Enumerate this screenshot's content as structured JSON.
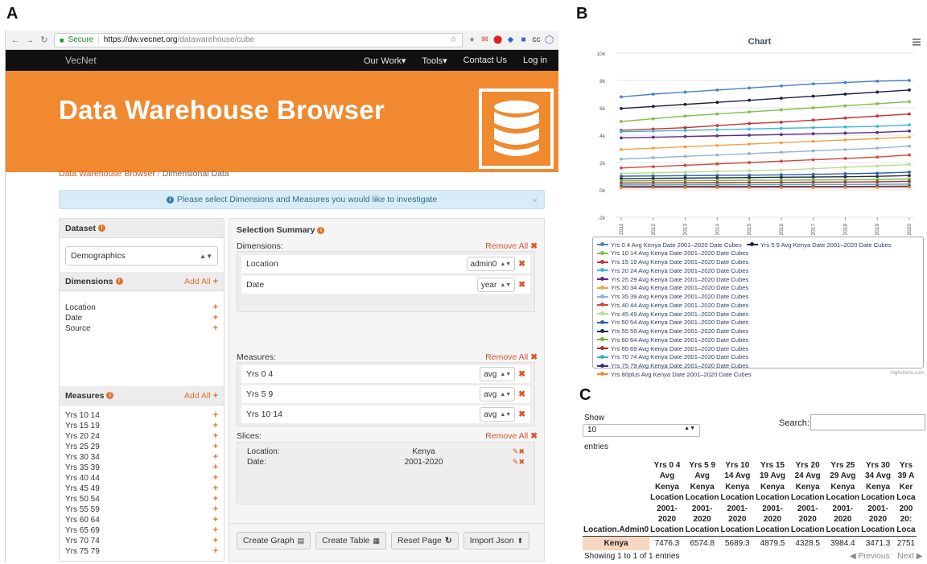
{
  "panel_labels": {
    "a": "A",
    "b": "B",
    "c": "C"
  },
  "browser": {
    "secure_label": "Secure",
    "url_host": "https://dw.vecnet.org",
    "url_path": "/datawarehouse/cube"
  },
  "nav": {
    "brand": "VecNet",
    "links": [
      "Our Work▾",
      "Tools▾",
      "Contact Us",
      "Log in"
    ]
  },
  "hero": {
    "title": "Data Warehouse Browser"
  },
  "breadcrumb": {
    "root": "Data Warehouse Browser",
    "sep": "/",
    "current": "Dimensional Data"
  },
  "alert": {
    "text": "Please select Dimensions and Measures you would like to investigate",
    "close": "×"
  },
  "dataset": {
    "title": "Dataset",
    "selected": "Demographics"
  },
  "dimensions": {
    "title": "Dimensions",
    "add_all": "Add All",
    "items": [
      "Location",
      "Date",
      "Source"
    ]
  },
  "measures": {
    "title": "Measures",
    "add_all": "Add All",
    "items": [
      "Yrs 10 14",
      "Yrs 15 19",
      "Yrs 20 24",
      "Yrs 25 29",
      "Yrs 30 34",
      "Yrs 35 39",
      "Yrs 40 44",
      "Yrs 45 49",
      "Yrs 50 54",
      "Yrs 55 59",
      "Yrs 60 64",
      "Yrs 65 69",
      "Yrs 70 74",
      "Yrs 75 79"
    ]
  },
  "summary": {
    "title": "Selection Summary",
    "remove_all": "Remove All",
    "dimensions_label": "Dimensions:",
    "dimensions": [
      {
        "name": "Location",
        "agg": "admin0"
      },
      {
        "name": "Date",
        "agg": "year"
      }
    ],
    "measures_label": "Measures:",
    "measures": [
      {
        "name": "Yrs 0 4",
        "agg": "avg"
      },
      {
        "name": "Yrs 5 9",
        "agg": "avg"
      },
      {
        "name": "Yrs 10 14",
        "agg": "avg"
      }
    ],
    "slices_label": "Slices:",
    "slices": [
      {
        "key": "Location:",
        "value": "Kenya"
      },
      {
        "key": "Date:",
        "value": "2001-2020"
      }
    ]
  },
  "buttons": {
    "create_graph": "Create Graph",
    "create_table": "Create Table",
    "reset_page": "Reset Page",
    "import_json": "Import Json"
  },
  "chart_data": {
    "type": "line",
    "title": "Chart",
    "x": [
      2011,
      2012,
      2013,
      2014,
      2015,
      2016,
      2017,
      2018,
      2019,
      2020
    ],
    "ylim": [
      -2000,
      10000
    ],
    "yticks": [
      -2000,
      0,
      2000,
      4000,
      6000,
      8000,
      10000
    ],
    "ytick_labels": [
      "-2k",
      "0k",
      "2k",
      "4k",
      "6k",
      "8k",
      "10k"
    ],
    "grid": true,
    "legend_position": "bottom",
    "credits": "Highcharts.com",
    "series": [
      {
        "name": "Yrs 0 4 Avg Kenya Date 2001–2020 Date Cubes",
        "color": "#4a7fcf",
        "values": [
          6800,
          7000,
          7150,
          7300,
          7450,
          7600,
          7750,
          7850,
          7950,
          8000
        ]
      },
      {
        "name": "Yrs 5 9 Avg Kenya Date 2001–2020 Date Cubes",
        "color": "#1c2040",
        "values": [
          5950,
          6100,
          6250,
          6400,
          6550,
          6700,
          6850,
          7000,
          7150,
          7300
        ]
      },
      {
        "name": "Yrs 10 14 Avg Kenya Date 2001–2020 Date Cubes",
        "color": "#7ec04a",
        "values": [
          5000,
          5200,
          5400,
          5550,
          5700,
          5850,
          6000,
          6150,
          6300,
          6450
        ]
      },
      {
        "name": "Yrs 15 19 Avg Kenya Date 2001–2020 Date Cubes",
        "color": "#c9302c",
        "values": [
          4350,
          4450,
          4550,
          4700,
          4850,
          4950,
          5100,
          5250,
          5400,
          5550
        ]
      },
      {
        "name": "Yrs 20 24 Avg Kenya Date 2001–2020 Date Cubes",
        "color": "#3fb7d6",
        "values": [
          4250,
          4300,
          4350,
          4400,
          4450,
          4500,
          4550,
          4600,
          4650,
          4750
        ]
      },
      {
        "name": "Yrs 25 29 Avg Kenya Date 2001–2020 Date Cubes",
        "color": "#5a2e87",
        "values": [
          3800,
          3850,
          3900,
          3950,
          4000,
          4050,
          4100,
          4150,
          4200,
          4300
        ]
      },
      {
        "name": "Yrs 30 34 Avg Kenya Date 2001–2020 Date Cubes",
        "color": "#f4a04a",
        "values": [
          2950,
          3050,
          3150,
          3250,
          3350,
          3450,
          3550,
          3650,
          3750,
          3850
        ]
      },
      {
        "name": "Yrs 35 39 Avg Kenya Date 2001–2020 Date Cubes",
        "color": "#90b4d8",
        "values": [
          2250,
          2350,
          2450,
          2550,
          2650,
          2750,
          2850,
          2950,
          3050,
          3200
        ]
      },
      {
        "name": "Yrs 40 44 Avg Kenya Date 2001–2020 Date Cubes",
        "color": "#d0483c",
        "values": [
          1600,
          1700,
          1800,
          1900,
          2000,
          2100,
          2200,
          2300,
          2400,
          2550
        ]
      },
      {
        "name": "Yrs 45 49 Avg Kenya Date 2001–2020 Date Cubes",
        "color": "#b8dc8c",
        "values": [
          1200,
          1250,
          1300,
          1350,
          1400,
          1450,
          1550,
          1650,
          1750,
          1850
        ]
      },
      {
        "name": "Yrs 50 54 Avg Kenya Date 2001–2020 Date Cubes",
        "color": "#2e5fa8",
        "values": [
          1000,
          1020,
          1040,
          1060,
          1080,
          1100,
          1140,
          1180,
          1220,
          1300
        ]
      },
      {
        "name": "Yrs 55 59 Avg Kenya Date 2001–2020 Date Cubes",
        "color": "#222a44",
        "values": [
          820,
          840,
          860,
          880,
          900,
          920,
          940,
          960,
          990,
          1050
        ]
      },
      {
        "name": "Yrs 60 64 Avg Kenya Date 2001–2020 Date Cubes",
        "color": "#6cb83c",
        "values": [
          660,
          670,
          680,
          690,
          700,
          710,
          720,
          730,
          760,
          800
        ]
      },
      {
        "name": "Yrs 65 69 Avg Kenya Date 2001–2020 Date Cubes",
        "color": "#b52e2a",
        "values": [
          500,
          510,
          520,
          530,
          540,
          550,
          560,
          570,
          590,
          620
        ]
      },
      {
        "name": "Yrs 70 74 Avg Kenya Date 2001–2020 Date Cubes",
        "color": "#3aaec8",
        "values": [
          360,
          365,
          370,
          375,
          380,
          385,
          390,
          395,
          405,
          420
        ]
      },
      {
        "name": "Yrs 75 79 Avg Kenya Date 2001–2020 Date Cubes",
        "color": "#4a2a78",
        "values": [
          240,
          242,
          244,
          246,
          248,
          250,
          252,
          255,
          260,
          270
        ]
      },
      {
        "name": "Yrs 80plus Avg Kenya Date 2001–2020 Date Cubes",
        "color": "#f08a3a",
        "values": [
          160,
          162,
          164,
          166,
          168,
          170,
          172,
          175,
          180,
          190
        ]
      }
    ]
  },
  "table": {
    "show_label": "Show",
    "length_value": "10",
    "entries_label": "entries",
    "search_label": "Search:",
    "headers": [
      "Location.Admin0",
      "Yrs 0 4\nAvg\nKenya\nLocation\n2001-\n2020\nLocation",
      "Yrs 5 9\nAvg\nKenya\nLocation\n2001-\n2020\nLocation",
      "Yrs 10\n14 Avg\nKenya\nLocation\n2001-\n2020\nLocation",
      "Yrs 15\n19 Avg\nKenya\nLocation\n2001-\n2020\nLocation",
      "Yrs 20\n24 Avg\nKenya\nLocation\n2001-\n2020\nLocation",
      "Yrs 25\n29 Avg\nKenya\nLocation\n2001-\n2020\nLocation",
      "Yrs 30\n34 Avg\nKenya\nLocation\n2001-\n2020\nLocation",
      "Yrs\n39 A\nKer\nLoca\n200\n20:\nLoca"
    ],
    "rows": [
      [
        "Kenya",
        "7476.3",
        "6574.8",
        "5689.3",
        "4879.5",
        "4328.5",
        "3984.4",
        "3471.3",
        "2751"
      ]
    ],
    "info": "Showing 1 to 1 of 1 entries",
    "previous": "◀ Previous",
    "next": "Next ▶"
  }
}
